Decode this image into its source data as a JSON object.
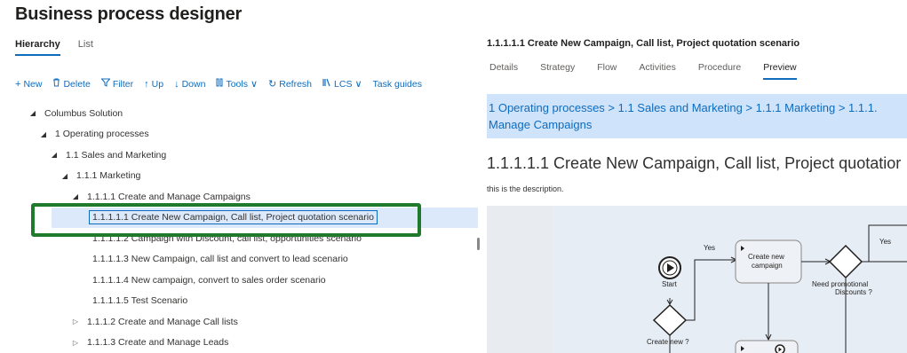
{
  "app": {
    "title": "Business process designer"
  },
  "view_tabs": [
    {
      "label": "Hierarchy",
      "active": true
    },
    {
      "label": "List",
      "active": false
    }
  ],
  "toolbar": {
    "new": {
      "icon": "plus-icon",
      "label": "New"
    },
    "delete": {
      "icon": "trash-icon",
      "label": "Delete"
    },
    "filter": {
      "icon": "filter-icon",
      "label": "Filter"
    },
    "up": {
      "icon": "arrow-up-icon",
      "label": "Up"
    },
    "down": {
      "icon": "arrow-down-icon",
      "label": "Down"
    },
    "tools": {
      "icon": "tools-icon",
      "label": "Tools"
    },
    "refresh": {
      "icon": "refresh-icon",
      "label": "Refresh"
    },
    "lcs": {
      "icon": "library-icon",
      "label": "LCS"
    },
    "task_guides": {
      "label": "Task guides"
    }
  },
  "tree": [
    {
      "label": "Columbus Solution",
      "level": 0,
      "state": "expanded"
    },
    {
      "label": "1 Operating processes",
      "level": 1,
      "state": "expanded"
    },
    {
      "label": "1.1 Sales and Marketing",
      "level": 2,
      "state": "expanded"
    },
    {
      "label": "1.1.1 Marketing",
      "level": 3,
      "state": "expanded"
    },
    {
      "label": "1.1.1.1 Create and Manage Campaigns",
      "level": 4,
      "state": "expanded"
    },
    {
      "label": "1.1.1.1.1 Create New Campaign, Call list, Project quotation scenario",
      "level": 5,
      "state": "leaf",
      "selected": true
    },
    {
      "label": "1.1.1.1.2 Campaign with Discount, call list, opportunities scenario",
      "level": 5,
      "state": "leaf"
    },
    {
      "label": "1.1.1.1.3 New Campaign, call list and convert to lead scenario",
      "level": 5,
      "state": "leaf"
    },
    {
      "label": "1.1.1.1.4 New campaign, convert to sales order scenario",
      "level": 5,
      "state": "leaf"
    },
    {
      "label": "1.1.1.1.5 Test Scenario",
      "level": 5,
      "state": "leaf"
    },
    {
      "label": "1.1.1.2 Create and Manage Call lists",
      "level": 4,
      "state": "collapsed"
    },
    {
      "label": "1.1.1.3 Create and Manage Leads",
      "level": 4,
      "state": "collapsed"
    }
  ],
  "detail": {
    "title": "1.1.1.1.1 Create New Campaign, Call list, Project quotation scenario",
    "tabs": [
      {
        "label": "Details",
        "active": false
      },
      {
        "label": "Strategy",
        "active": false
      },
      {
        "label": "Flow",
        "active": false
      },
      {
        "label": "Activities",
        "active": false
      },
      {
        "label": "Procedure",
        "active": false
      },
      {
        "label": "Preview",
        "active": true
      }
    ],
    "breadcrumb_line1": "1 Operating processes > 1.1 Sales and Marketing > 1.1.1 Marketing > 1.1.1.",
    "breadcrumb_line2": "Manage Campaigns",
    "heading": "1.1.1.1.1 Create New Campaign, Call list, Project quotatior",
    "description": "this is the description."
  },
  "diagram": {
    "start": "Start",
    "create_new_q": "Create new ?",
    "yes1": "Yes",
    "task1_line1": "Create new",
    "task1_line2": "campaign",
    "need_promo_line1": "Need promotional",
    "need_promo_line2": "Discounts ?",
    "yes2": "Yes"
  },
  "colors": {
    "accent": "#0f6cbd",
    "selection_bg": "#dbe9fb",
    "highlight_border": "#1f7a2c",
    "breadcrumb_bg": "#cfe3fa"
  }
}
